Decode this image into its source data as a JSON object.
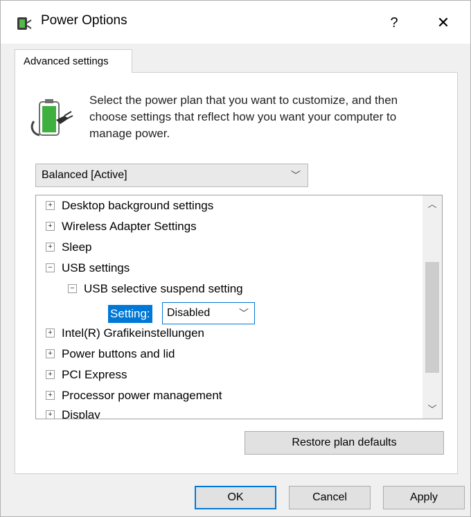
{
  "window": {
    "title": "Power Options",
    "help_label": "?",
    "close_label": "✕"
  },
  "tab": {
    "label": "Advanced settings"
  },
  "description": "Select the power plan that you want to customize, and then choose settings that reflect how you want your computer to manage power.",
  "plan_select": {
    "value": "Balanced [Active]"
  },
  "tree": {
    "items": [
      {
        "label": "Desktop background settings",
        "expander": "+"
      },
      {
        "label": "Wireless Adapter Settings",
        "expander": "+"
      },
      {
        "label": "Sleep",
        "expander": "+"
      },
      {
        "label": "USB settings",
        "expander": "−"
      },
      {
        "label": "USB selective suspend setting",
        "expander": "−"
      },
      {
        "label": "Intel(R) Grafikeinstellungen",
        "expander": "+"
      },
      {
        "label": "Power buttons and lid",
        "expander": "+"
      },
      {
        "label": "PCI Express",
        "expander": "+"
      },
      {
        "label": "Processor power management",
        "expander": "+"
      },
      {
        "label": "Display",
        "expander": "+"
      }
    ],
    "setting_label": "Setting:",
    "setting_value": "Disabled"
  },
  "buttons": {
    "restore": "Restore plan defaults",
    "ok": "OK",
    "cancel": "Cancel",
    "apply": "Apply"
  },
  "colors": {
    "accent": "#0078d7",
    "battery": "#3fb03f"
  },
  "icons": {
    "app": "power-plug-icon",
    "battery": "battery-plug-icon"
  }
}
